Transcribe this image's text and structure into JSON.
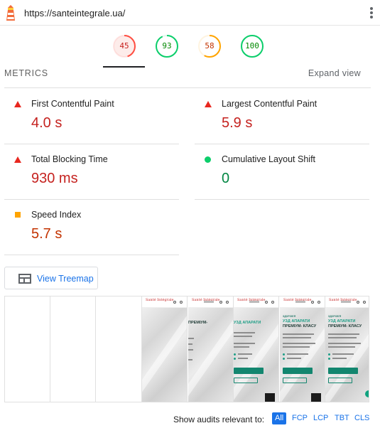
{
  "header": {
    "url": "https://santeintegrale.ua/",
    "logo_icon": "lighthouse-icon",
    "menu_icon": "kebab-menu-icon"
  },
  "gauges": [
    {
      "score": "45",
      "ratio": 0.45,
      "color": "#ff4e42",
      "bg": "#fdecea"
    },
    {
      "score": "93",
      "ratio": 0.93,
      "color": "#0cce6b",
      "bg": "#ffffff"
    },
    {
      "score": "58",
      "ratio": 0.58,
      "color": "#ffa400",
      "bg": "#ffffff"
    },
    {
      "score": "100",
      "ratio": 1.0,
      "color": "#0cce6b",
      "bg": "#ffffff"
    }
  ],
  "metrics": {
    "title": "METRICS",
    "expand_label": "Expand view",
    "items": [
      {
        "label": "First Contentful Paint",
        "value": "4.0 s",
        "status": "fail"
      },
      {
        "label": "Largest Contentful Paint",
        "value": "5.9 s",
        "status": "fail"
      },
      {
        "label": "Total Blocking Time",
        "value": "930 ms",
        "status": "fail"
      },
      {
        "label": "Cumulative Layout Shift",
        "value": "0",
        "status": "pass"
      },
      {
        "label": "Speed Index",
        "value": "5.7 s",
        "status": "average"
      }
    ]
  },
  "treemap": {
    "label": "View Treemap"
  },
  "filmstrip": {
    "logo_text": "Santé Intégrale",
    "hero_small": "ЗДОРОВ'Я",
    "hero_title_1": "УЗД АПАРАТИ",
    "hero_title_2": "ПРЕМІУМ-",
    "hero_title_3": "КЛАСУ"
  },
  "audits": {
    "label": "Show audits relevant to:",
    "filters": [
      "All",
      "FCP",
      "LCP",
      "TBT",
      "CLS"
    ],
    "active": "All"
  }
}
